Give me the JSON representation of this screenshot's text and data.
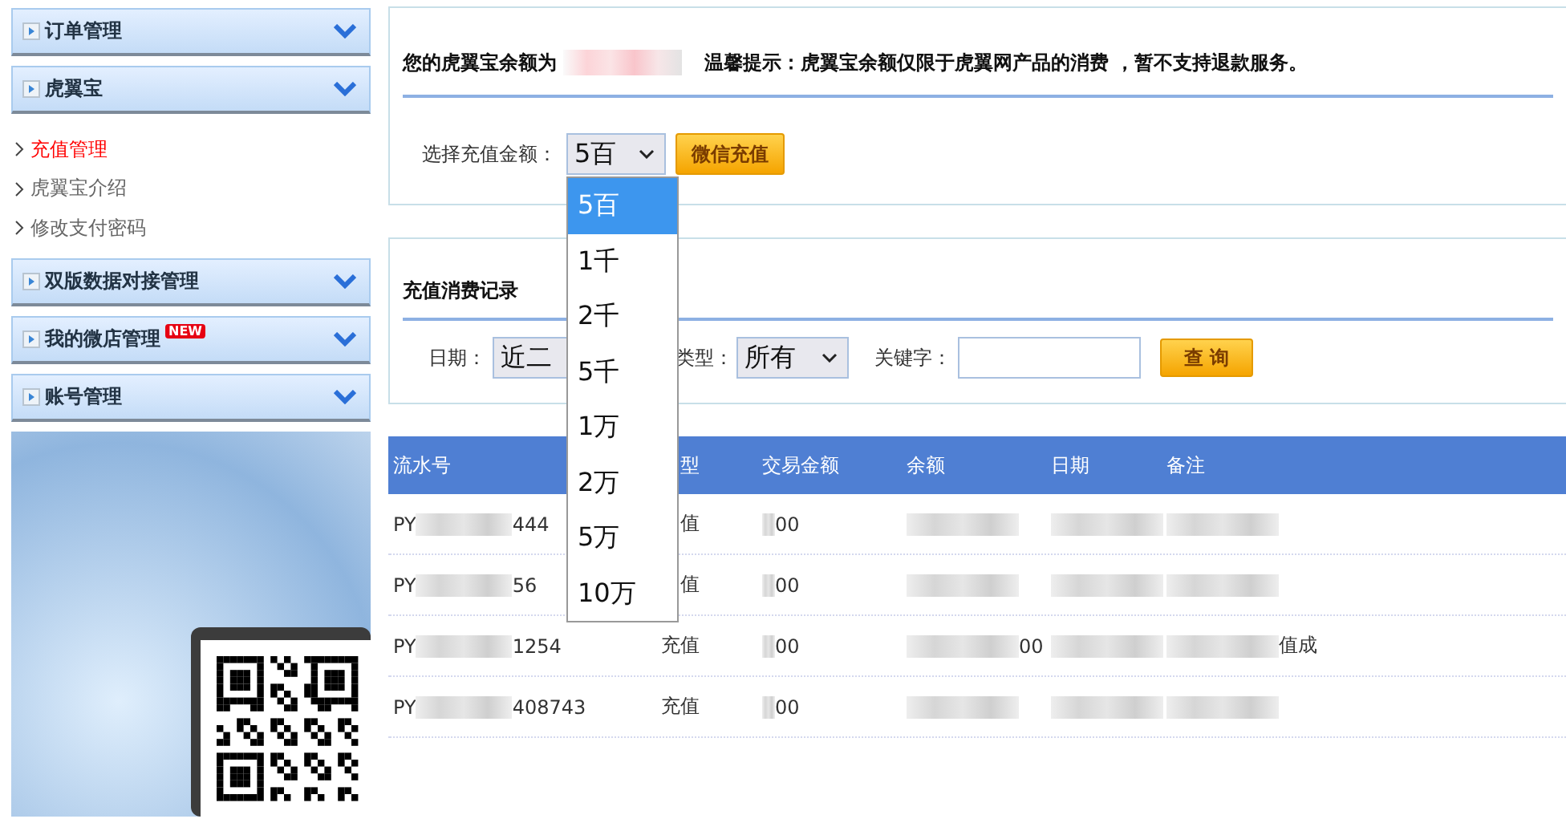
{
  "sidebar": {
    "groups": [
      {
        "label": "订单管理"
      },
      {
        "label": "虎翼宝",
        "children": [
          {
            "label": "充值管理",
            "selected": true
          },
          {
            "label": "虎翼宝介绍",
            "selected": false
          },
          {
            "label": "修改支付密码",
            "selected": false
          }
        ]
      },
      {
        "label": "双版数据对接管理"
      },
      {
        "label": "我的微店管理",
        "badge": "NEW"
      },
      {
        "label": "账号管理"
      }
    ]
  },
  "balance": {
    "label": "您的虎翼宝余额为",
    "notice": "温馨提示：虎翼宝余额仅限于虎翼网产品的消费 ，暂不支持退款服务。"
  },
  "recharge": {
    "label": "选择充值金额：",
    "value": "5百",
    "button": "微信充值",
    "options": [
      {
        "label": "5百",
        "selected": true
      },
      {
        "label": "1千",
        "selected": false
      },
      {
        "label": "2千",
        "selected": false
      },
      {
        "label": "5千",
        "selected": false
      },
      {
        "label": "1万",
        "selected": false
      },
      {
        "label": "2万",
        "selected": false
      },
      {
        "label": "5万",
        "selected": false
      },
      {
        "label": "10万",
        "selected": false
      }
    ]
  },
  "records": {
    "title": "充值消费记录",
    "date_label": "日期：",
    "date_value": "近二",
    "type_label": "类型：",
    "type_value": "所有",
    "keyword_label": "关键字：",
    "search_button": "查 询"
  },
  "table": {
    "columns": [
      "流水号",
      "型",
      "交易金额",
      "余额",
      "日期",
      "备注"
    ],
    "rows": [
      [
        [
          {
            "kind": "text",
            "text": "PY"
          },
          {
            "kind": "blur"
          },
          {
            "kind": "text",
            "text": "444"
          }
        ],
        [
          {
            "kind": "text",
            "text": "值"
          }
        ],
        [
          {
            "kind": "blur"
          },
          {
            "kind": "text",
            "text": "00"
          }
        ],
        [
          {
            "kind": "blur"
          }
        ],
        [
          {
            "kind": "blur"
          }
        ],
        [
          {
            "kind": "blur"
          }
        ]
      ],
      [
        [
          {
            "kind": "text",
            "text": "PY"
          },
          {
            "kind": "blur"
          },
          {
            "kind": "text",
            "text": "56"
          }
        ],
        [
          {
            "kind": "text",
            "text": "值"
          }
        ],
        [
          {
            "kind": "blur"
          },
          {
            "kind": "text",
            "text": "00"
          }
        ],
        [
          {
            "kind": "blur"
          }
        ],
        [
          {
            "kind": "blur"
          }
        ],
        [
          {
            "kind": "blur"
          }
        ]
      ],
      [
        [
          {
            "kind": "text",
            "text": "PY"
          },
          {
            "kind": "blur"
          },
          {
            "kind": "text",
            "text": "1254"
          }
        ],
        [
          {
            "kind": "text",
            "text": "充值"
          }
        ],
        [
          {
            "kind": "blur"
          },
          {
            "kind": "text",
            "text": "00"
          }
        ],
        [
          {
            "kind": "blur"
          },
          {
            "kind": "text",
            "text": "00"
          }
        ],
        [
          {
            "kind": "blur"
          }
        ],
        [
          {
            "kind": "blur"
          },
          {
            "kind": "text",
            "text": "值成"
          }
        ]
      ],
      [
        [
          {
            "kind": "text",
            "text": "PY"
          },
          {
            "kind": "blur"
          },
          {
            "kind": "text",
            "text": "408743"
          }
        ],
        [
          {
            "kind": "text",
            "text": "充值"
          }
        ],
        [
          {
            "kind": "blur"
          },
          {
            "kind": "text",
            "text": "00"
          }
        ],
        [
          {
            "kind": "blur"
          }
        ],
        [
          {
            "kind": "blur"
          }
        ],
        [
          {
            "kind": "blur"
          }
        ]
      ]
    ]
  }
}
